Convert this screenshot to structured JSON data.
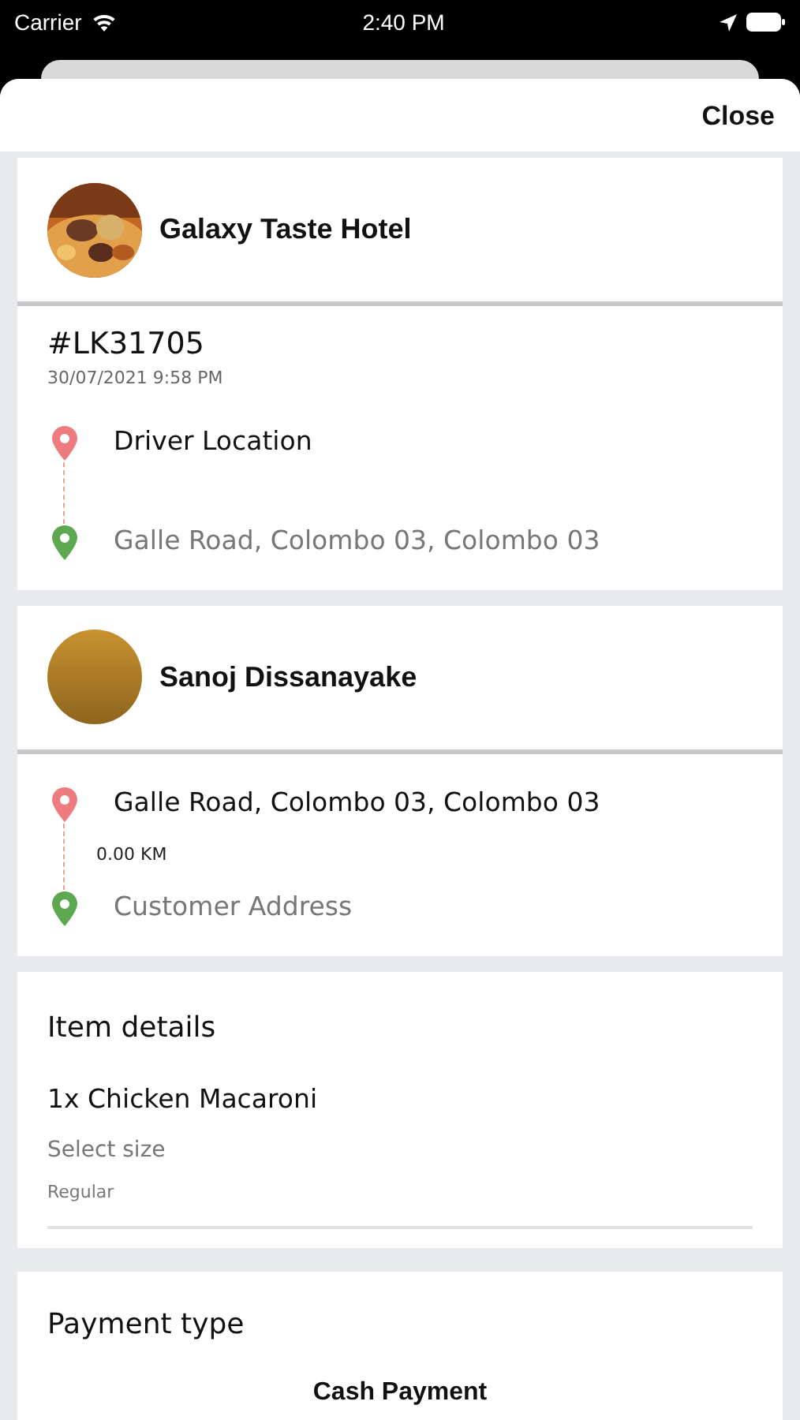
{
  "status_bar": {
    "carrier": "Carrier",
    "time": "2:40 PM"
  },
  "close": "Close",
  "restaurant": {
    "name": "Galaxy Taste Hotel",
    "order_id": "#LK31705",
    "datetime": "30/07/2021 9:58 PM",
    "route": [
      {
        "kind": "origin",
        "label": "Driver Location",
        "color": "#ee7b7f"
      },
      {
        "kind": "destination",
        "label": "Galle Road, Colombo 03, Colombo 03",
        "color": "#5fa852"
      }
    ]
  },
  "customer": {
    "name": "Sanoj Dissanayake",
    "distance": "0.00 KM",
    "route": [
      {
        "kind": "origin",
        "label": "Galle Road, Colombo 03, Colombo 03",
        "color": "#ee7b7f"
      },
      {
        "kind": "destination",
        "label": "Customer Address",
        "color": "#5fa852"
      }
    ]
  },
  "items": {
    "title": "Item details",
    "item": "1x Chicken Macaroni",
    "option_label": "Select size",
    "option_value": "Regular"
  },
  "payment": {
    "title": "Payment type",
    "method": "Cash Payment"
  }
}
